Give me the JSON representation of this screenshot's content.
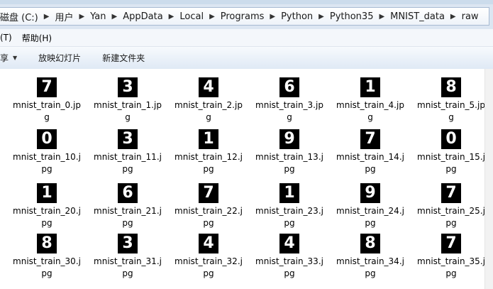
{
  "address_bar": {
    "crumbs": [
      "磁盘 (C:)",
      "用户",
      "Yan",
      "AppData",
      "Local",
      "Programs",
      "Python",
      "Python35",
      "MNIST_data",
      "raw"
    ]
  },
  "menu": {
    "items": [
      "(T)",
      "帮助(H)"
    ]
  },
  "toolbar": {
    "share_label": "享",
    "slideshow_label": "放映幻灯片",
    "new_folder_label": "新建文件夹"
  },
  "files": [
    {
      "name1": "mnist_train_0.jp",
      "name2": "g",
      "digit": "7"
    },
    {
      "name1": "mnist_train_1.jp",
      "name2": "g",
      "digit": "3"
    },
    {
      "name1": "mnist_train_2.jp",
      "name2": "g",
      "digit": "4"
    },
    {
      "name1": "mnist_train_3.jp",
      "name2": "g",
      "digit": "6"
    },
    {
      "name1": "mnist_train_4.jp",
      "name2": "g",
      "digit": "1"
    },
    {
      "name1": "mnist_train_5.jp",
      "name2": "g",
      "digit": "8"
    },
    {
      "name1": "mnist_train_10.j",
      "name2": "pg",
      "digit": "0"
    },
    {
      "name1": "mnist_train_11.j",
      "name2": "pg",
      "digit": "3"
    },
    {
      "name1": "mnist_train_12.j",
      "name2": "pg",
      "digit": "1"
    },
    {
      "name1": "mnist_train_13.j",
      "name2": "pg",
      "digit": "9"
    },
    {
      "name1": "mnist_train_14.j",
      "name2": "pg",
      "digit": "7"
    },
    {
      "name1": "mnist_train_15.j",
      "name2": "pg",
      "digit": "0"
    },
    {
      "name1": "mnist_train_20.j",
      "name2": "pg",
      "digit": "1"
    },
    {
      "name1": "mnist_train_21.j",
      "name2": "pg",
      "digit": "6"
    },
    {
      "name1": "mnist_train_22.j",
      "name2": "pg",
      "digit": "7"
    },
    {
      "name1": "mnist_train_23.j",
      "name2": "pg",
      "digit": "1"
    },
    {
      "name1": "mnist_train_24.j",
      "name2": "pg",
      "digit": "9"
    },
    {
      "name1": "mnist_train_25.j",
      "name2": "pg",
      "digit": "7"
    },
    {
      "name1": "mnist_train_30.j",
      "name2": "pg",
      "digit": "8"
    },
    {
      "name1": "mnist_train_31.j",
      "name2": "pg",
      "digit": "3"
    },
    {
      "name1": "mnist_train_32.j",
      "name2": "pg",
      "digit": "4"
    },
    {
      "name1": "mnist_train_33.j",
      "name2": "pg",
      "digit": "4"
    },
    {
      "name1": "mnist_train_34.j",
      "name2": "pg",
      "digit": "8"
    },
    {
      "name1": "mnist_train_35.j",
      "name2": "pg",
      "digit": "7"
    }
  ]
}
